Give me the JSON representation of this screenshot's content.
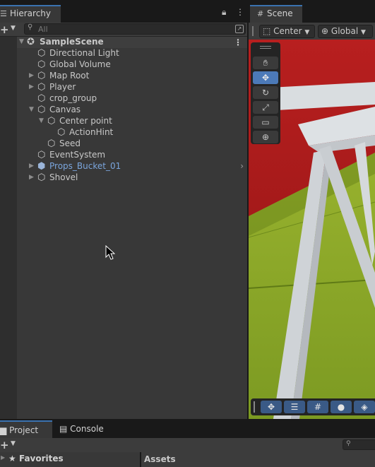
{
  "hierarchy": {
    "tab_label": "Hierarchy",
    "search_placeholder": "All",
    "scene_name": "SampleScene",
    "items": [
      {
        "label": "Directional Light",
        "depth": 1,
        "expandable": "none"
      },
      {
        "label": "Global Volume",
        "depth": 1,
        "expandable": "none"
      },
      {
        "label": "Map Root",
        "depth": 1,
        "expandable": "collapsed"
      },
      {
        "label": "Player",
        "depth": 1,
        "expandable": "collapsed"
      },
      {
        "label": "crop_group",
        "depth": 1,
        "expandable": "none"
      },
      {
        "label": "Canvas",
        "depth": 1,
        "expandable": "expanded"
      },
      {
        "label": "Center point",
        "depth": 2,
        "expandable": "expanded"
      },
      {
        "label": "ActionHint",
        "depth": 3,
        "expandable": "none"
      },
      {
        "label": "Seed",
        "depth": 2,
        "expandable": "none"
      },
      {
        "label": "EventSystem",
        "depth": 1,
        "expandable": "none"
      },
      {
        "label": "Props_Bucket_01",
        "depth": 1,
        "expandable": "collapsed",
        "prefab": true
      },
      {
        "label": "Shovel",
        "depth": 1,
        "expandable": "collapsed"
      }
    ]
  },
  "scene": {
    "tab_label": "Scene",
    "pivot_label": "Center",
    "space_label": "Global"
  },
  "bottom": {
    "tabs": [
      "Project",
      "Console"
    ],
    "favorites_label": "Favorites",
    "assets_label": "Assets"
  },
  "colors": {
    "accent": "#3a72b0",
    "panel": "#383838",
    "prefab_text": "#7aa5dc",
    "scene_red": "#b51e1e",
    "scene_green": "#8aa82a"
  }
}
